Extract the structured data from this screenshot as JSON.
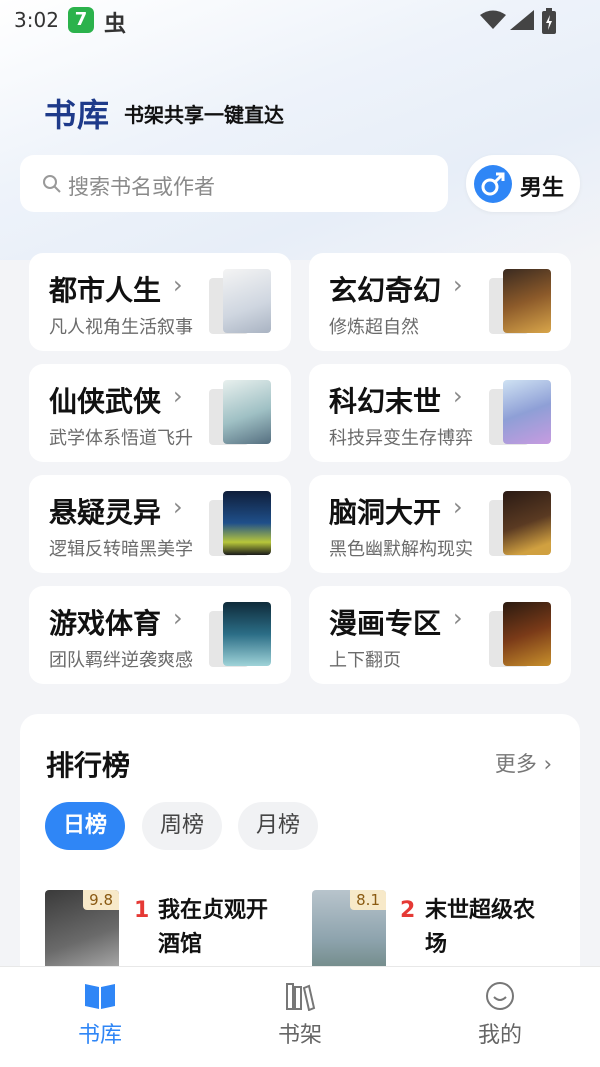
{
  "status_bar": {
    "time": "3:02",
    "app_badge": "7",
    "bug_glyph": "虫"
  },
  "header": {
    "title": "书库",
    "subtitle": "书架共享一键直达"
  },
  "search": {
    "placeholder": "搜索书名或作者"
  },
  "gender": {
    "label": "男生"
  },
  "categories": [
    {
      "title": "都市人生",
      "subtitle": "凡人视角生活叙事"
    },
    {
      "title": "玄幻奇幻",
      "subtitle": "修炼超自然"
    },
    {
      "title": "仙侠武侠",
      "subtitle": "武学体系悟道飞升"
    },
    {
      "title": "科幻末世",
      "subtitle": "科技异变生存博弈"
    },
    {
      "title": "悬疑灵异",
      "subtitle": "逻辑反转暗黑美学"
    },
    {
      "title": "脑洞大开",
      "subtitle": "黑色幽默解构现实"
    },
    {
      "title": "游戏体育",
      "subtitle": "团队羁绊逆袭爽感"
    },
    {
      "title": "漫画专区",
      "subtitle": "上下翻页"
    }
  ],
  "ranking": {
    "title": "排行榜",
    "more": "更多",
    "tabs": [
      "日榜",
      "周榜",
      "月榜"
    ],
    "books": [
      {
        "rank": "1",
        "title": "我在贞观开酒馆",
        "score": "9.8"
      },
      {
        "rank": "2",
        "title": "末世超级农场",
        "score": "8.1"
      }
    ]
  },
  "nav": [
    {
      "label": "书库"
    },
    {
      "label": "书架"
    },
    {
      "label": "我的"
    }
  ],
  "colors": {
    "accent": "#2f86f6",
    "header_title": "#1e3a8a",
    "rank_red": "#e53935"
  }
}
